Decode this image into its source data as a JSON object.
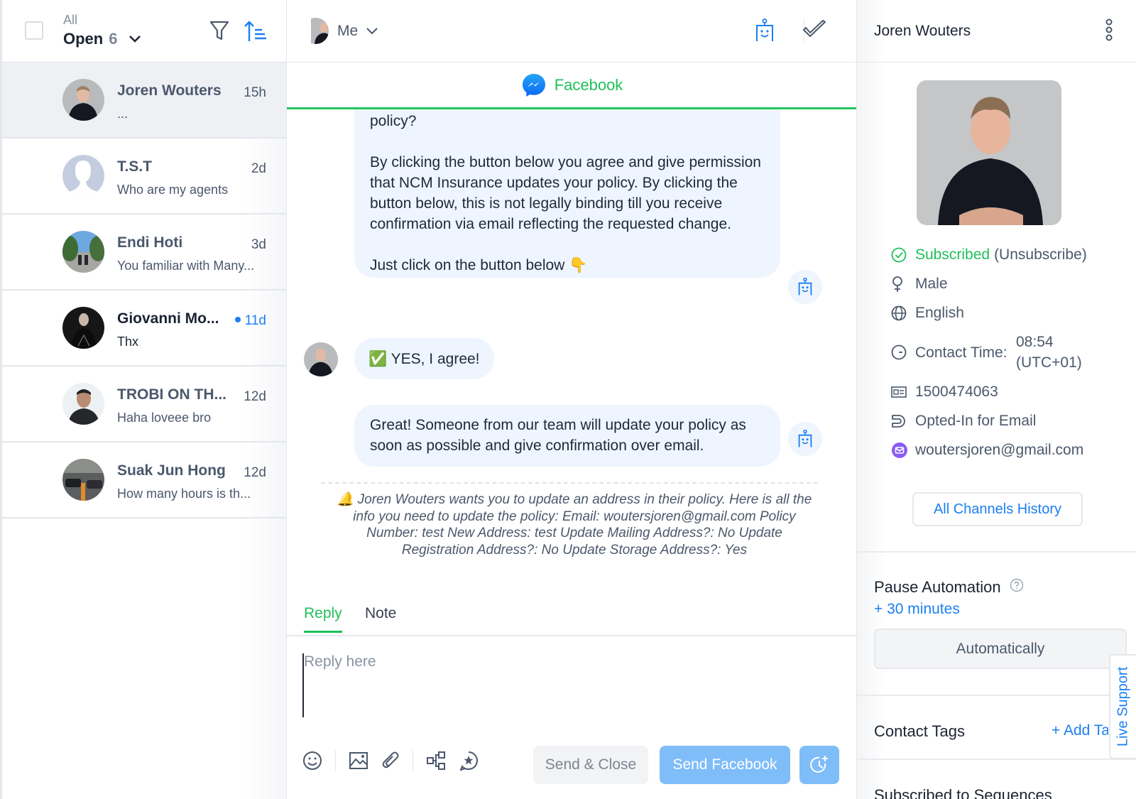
{
  "inbox": {
    "filter_scope": "All",
    "filter_status": "Open",
    "filter_count": "6",
    "conversations": [
      {
        "name": "Joren Wouters",
        "time": "15h",
        "preview": "...",
        "unread": false,
        "active": true
      },
      {
        "name": "T.S.T",
        "time": "2d",
        "preview": "Who are my agents",
        "unread": false,
        "active": false
      },
      {
        "name": "Endi Hoti",
        "time": "3d",
        "preview": "You familiar with Many...",
        "unread": false,
        "active": false
      },
      {
        "name": "Giovanni Mo...",
        "time": "11d",
        "preview": "Thx",
        "unread": true,
        "active": false
      },
      {
        "name": "TROBI ON TH...",
        "time": "12d",
        "preview": "Haha loveee bro",
        "unread": false,
        "active": false
      },
      {
        "name": "Suak Jun Hong",
        "time": "12d",
        "preview": "How many hours is th...",
        "unread": false,
        "active": false
      }
    ]
  },
  "conversation": {
    "assignee": "Me",
    "channel": "Facebook",
    "messages": {
      "bot_1_line_top": "policy?",
      "bot_1_para_2": "By clicking the button below you agree and give permission that NCM Insurance updates your policy. By clicking the button below, this is not legally binding till you receive confirmation via email reflecting the requested change.",
      "bot_1_para_3": "Just click on the button below 👇",
      "user_reply": "✅ YES, I agree!",
      "bot_2": "Great! Someone from our team will update your policy as soon as possible and give confirmation over email."
    },
    "system_note": "🔔 Joren Wouters wants you to update an address in their policy. Here is all the info you need to update the policy: Email: woutersjoren@gmail.com Policy Number: test New Address: test Update Mailing Address?: No Update Registration Address?: No Update Storage Address?: Yes",
    "composer": {
      "tab_reply": "Reply",
      "tab_note": "Note",
      "placeholder": "Reply here",
      "value": "",
      "send_close_label": "Send & Close",
      "send_label": "Send Facebook"
    }
  },
  "contact": {
    "name": "Joren Wouters",
    "subscription_status": "Subscribed",
    "unsubscribe_label": "(Unsubscribe)",
    "gender": "Male",
    "language": "English",
    "contact_time_label": "Contact Time:",
    "contact_time_value": "08:54 (UTC+01)",
    "id": "1500474063",
    "email_opt_in": "Opted-In for Email",
    "email": "woutersjoren@gmail.com",
    "history_button": "All Channels History",
    "pause_automation_title": "Pause Automation",
    "pause_link": "+ 30 minutes",
    "automation_button": "Automatically",
    "tags_title": "Contact Tags",
    "add_tag_label": "+ Add Tag",
    "sequences_title": "Subscribed to Sequences",
    "live_support_label": "Live Support"
  },
  "colors": {
    "accent_green": "#1fc05a",
    "accent_blue": "#1c7ff0",
    "bubble_bg": "#eef5fe",
    "send_button": "#7fbdf8"
  }
}
